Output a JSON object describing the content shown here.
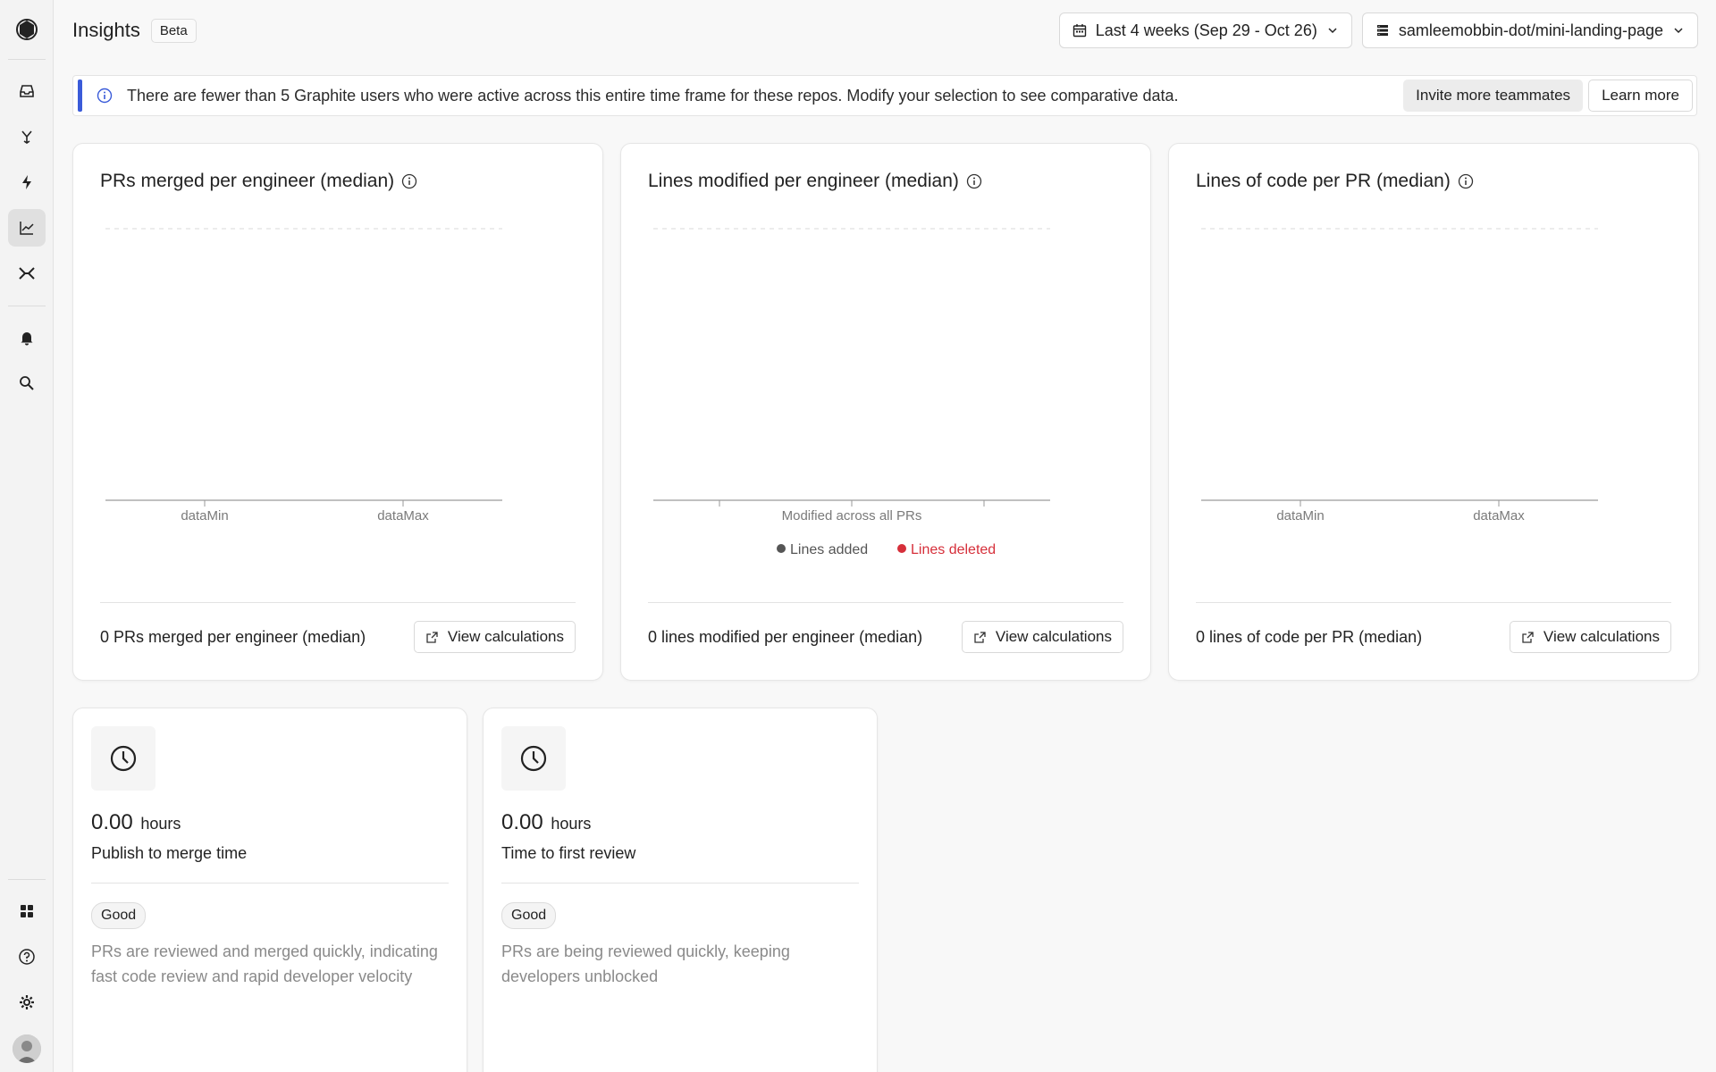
{
  "sidebar": {
    "items": [
      {
        "name": "sidebar-item-inbox",
        "icon": "inbox-icon"
      },
      {
        "name": "sidebar-item-merge",
        "icon": "merge-icon"
      },
      {
        "name": "sidebar-item-activity",
        "icon": "bolt-icon"
      },
      {
        "name": "sidebar-item-insights",
        "icon": "chart-line-icon",
        "active": true
      },
      {
        "name": "sidebar-item-stacks",
        "icon": "stack-icon"
      },
      {
        "name": "sidebar-item-notifications",
        "icon": "bell-icon"
      },
      {
        "name": "sidebar-item-search",
        "icon": "search-icon"
      }
    ],
    "bottom": [
      {
        "name": "sidebar-item-apps",
        "icon": "grid-icon"
      },
      {
        "name": "sidebar-item-help",
        "icon": "help-icon"
      },
      {
        "name": "sidebar-item-settings",
        "icon": "gear-icon"
      }
    ]
  },
  "header": {
    "title": "Insights",
    "badge": "Beta",
    "date_range": "Last 4 weeks (Sep 29 - Oct 26)",
    "repo": "samleemobbin-dot/mini-landing-page"
  },
  "banner": {
    "text": "There are fewer than 5 Graphite users who were active across this entire time frame for these repos. Modify your selection to see comparative data.",
    "invite_label": "Invite more teammates",
    "learn_label": "Learn more",
    "accent": "#3a5bd9"
  },
  "charts": [
    {
      "title": "PRs merged per engineer (median)",
      "footer": "0 PRs merged per engineer (median)",
      "button": "View calculations",
      "ticks": [
        "dataMin",
        "dataMax"
      ]
    },
    {
      "title": "Lines modified per engineer (median)",
      "footer": "0 lines modified per engineer (median)",
      "button": "View calculations",
      "xlabel": "Modified across all PRs",
      "legend": [
        {
          "label": "Lines added",
          "color": "#555555"
        },
        {
          "label": "Lines deleted",
          "color": "#d62f3a"
        }
      ]
    },
    {
      "title": "Lines of code per PR (median)",
      "footer": "0 lines of code per PR (median)",
      "button": "View calculations",
      "ticks": [
        "dataMin",
        "dataMax"
      ]
    }
  ],
  "chart_data": [
    {
      "type": "bar",
      "title": "PRs merged per engineer (median)",
      "categories": [],
      "values": [],
      "xticks": [
        "dataMin",
        "dataMax"
      ]
    },
    {
      "type": "bar",
      "title": "Lines modified per engineer (median)",
      "xlabel": "Modified across all PRs",
      "series": [
        {
          "name": "Lines added",
          "values": []
        },
        {
          "name": "Lines deleted",
          "values": []
        }
      ]
    },
    {
      "type": "bar",
      "title": "Lines of code per PR (median)",
      "categories": [],
      "values": [],
      "xticks": [
        "dataMin",
        "dataMax"
      ]
    }
  ],
  "metrics": [
    {
      "value": "0.00",
      "unit": "hours",
      "label": "Publish to merge time",
      "badge": "Good",
      "description": "PRs are reviewed and merged quickly, indicating fast code review and rapid developer velocity",
      "icon": "clock-icon"
    },
    {
      "value": "0.00",
      "unit": "hours",
      "label": "Time to first review",
      "badge": "Good",
      "description": "PRs are being reviewed quickly, keeping developers unblocked",
      "icon": "clock-icon"
    }
  ]
}
